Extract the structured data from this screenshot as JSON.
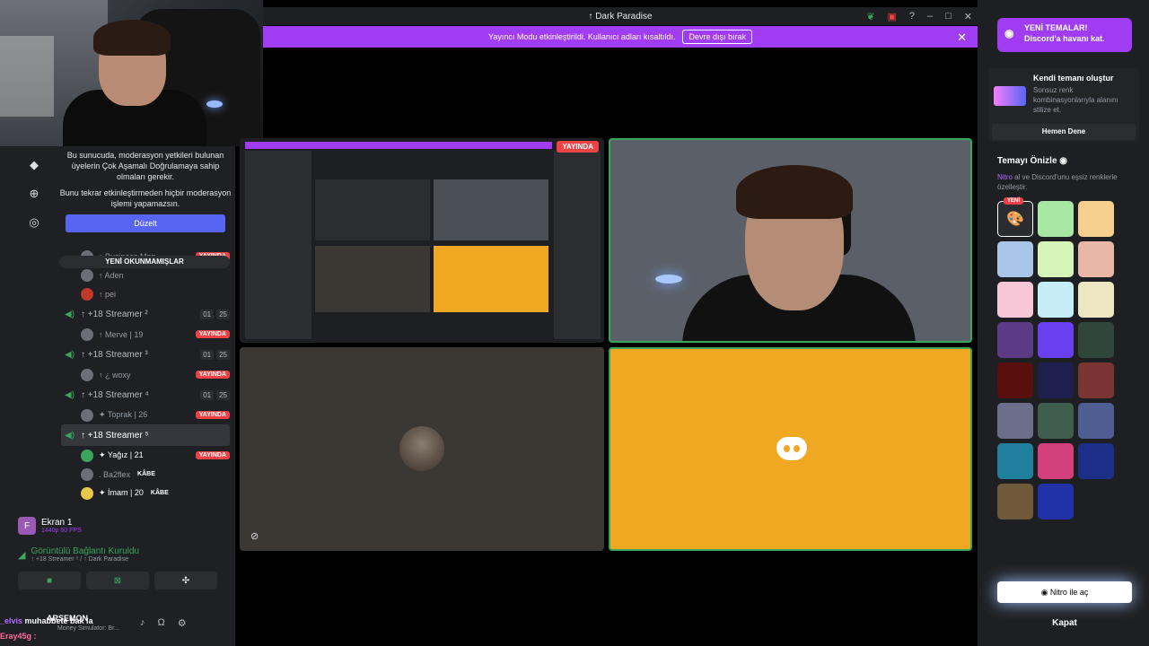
{
  "window": {
    "title": "↑ Dark Paradise"
  },
  "banner": {
    "text": "Yayıncı Modu etkinleştirildi. Kullanıcı adları kısaltıldı.",
    "button": "Devre dışı bırak"
  },
  "popup": {
    "line1": "Bu sunucuda, moderasyon yetkileri bulunan üyelerin Çok Aşamalı Doğrulamaya sahip olmaları gerekir.",
    "line2": "Bunu tekrar etkinleştirmeden hiçbir moderasyon işlemi yapamazsın.",
    "button": "Düzelt"
  },
  "unread_label": "YENİ OKUNMAMIŞLAR",
  "live_badge": "YAYINDA",
  "kabe_badge": "KÂBE",
  "channels": {
    "top_users": [
      "↑ Business Man ...",
      "↑ Aden",
      "↑ pei"
    ],
    "ch1": {
      "name": "↑ +18 Streamer ²",
      "n1": "01",
      "n2": "25",
      "users": [
        "↑ Merve | 19"
      ]
    },
    "ch2": {
      "name": "↑ +18 Streamer ³",
      "n1": "01",
      "n2": "25",
      "users": [
        "↑ ¿ woxy"
      ]
    },
    "ch3": {
      "name": "↑ +18 Streamer ⁴",
      "n1": "01",
      "n2": "25",
      "users": [
        "✦ Toprak | 26"
      ]
    },
    "ch4": {
      "name": "↑ +18 Streamer ⁵",
      "users": [
        "✦ Yağız | 21",
        ". Ba2flex",
        "✦ İmam | 20"
      ]
    }
  },
  "screen": {
    "title": "Ekran 1",
    "sub": "1440p 60 FPS"
  },
  "connection": {
    "title": "Görüntülü Bağlantı Kuruldu",
    "sub": "↑ +18 Streamer ⁵ / ↑ Dark Paradise"
  },
  "bottom": {
    "name": "ARSEMON",
    "sub": "Money Simulator: Br..."
  },
  "chat": [
    {
      "name": "_elvis",
      "text": "muhabbete bak la"
    },
    {
      "name": "Eray45g :",
      "text": ""
    }
  ],
  "mini_live": "YAYINDA",
  "theme_promo": {
    "title": "YENİ TEMALAR!",
    "sub": "Discord'a havanı kat."
  },
  "custom_theme": {
    "title": "Kendi temanı oluştur",
    "desc": "Sonsuz renk kombinasyonlarıyla alanını stilize et.",
    "button": "Hemen Dene"
  },
  "preview": {
    "title": "Temayı Önizle",
    "desc_nitro": "Nitro",
    "desc_rest": " al ve Discord'unu eşsiz renklerle özelleştir.",
    "new_badge": "YENİ"
  },
  "swatches": [
    "#2a2c31",
    "#a8e6a3",
    "#f7cf8f",
    "#a9c6e8",
    "#d6f3b8",
    "#e8b7a6",
    "#f7c7d8",
    "#c6ecf5",
    "#ece6c2",
    "#5c3a86",
    "#6a3ff0",
    "#31463a",
    "#5a0f0f",
    "#1e1f4f",
    "#7a3434",
    "#6c6f8a",
    "#3f5e4e",
    "#4e5e93",
    "#1f7f9c",
    "#d23f7a",
    "#1b2f88",
    "#6e5a3a",
    "#2231a8"
  ],
  "actions": {
    "nitro": "Nitro ile aç",
    "close": "Kapat"
  },
  "colors": {
    "accent": "#a03cf3",
    "green": "#3ba55d",
    "red": "#ed4245",
    "discord_orange": "#f0a823"
  }
}
